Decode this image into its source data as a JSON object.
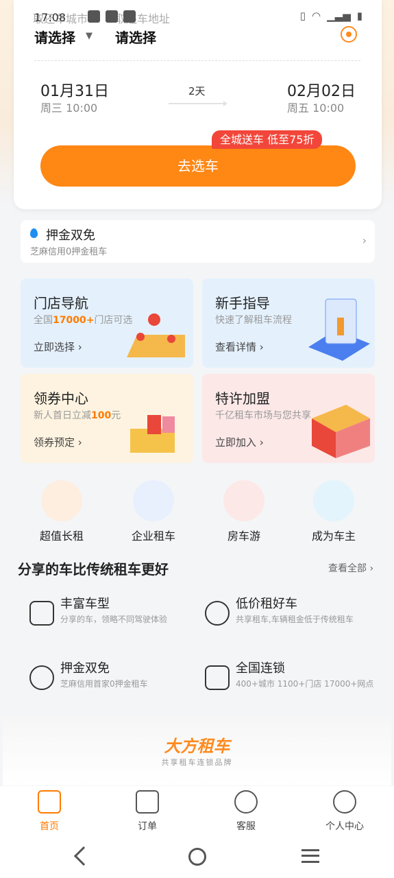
{
  "status": {
    "time": "17:08"
  },
  "booking": {
    "city_hint": "取还车城市",
    "addr_hint": "取还车地址",
    "city_value": "请选择",
    "addr_value": "请选择",
    "pickup_date": "01月31日",
    "pickup_week": "周三 10:00",
    "duration": "2天",
    "return_date": "02月02日",
    "return_week": "周五 10:00",
    "promo": "全城送车 低至75折",
    "go_label": "去选车"
  },
  "deposit": {
    "title": "押金双免",
    "sub": "芝麻信用0押金租车"
  },
  "tiles": [
    {
      "title": "门店导航",
      "sub_a": "全国",
      "sub_highlight": "17000+",
      "sub_b": "门店可选",
      "action": "立即选择"
    },
    {
      "title": "新手指导",
      "sub": "快速了解租车流程",
      "action": "查看详情"
    },
    {
      "title": "领券中心",
      "sub_a": "新人首日立减",
      "sub_highlight": "100",
      "sub_b": "元",
      "action": "领券预定"
    },
    {
      "title": "特许加盟",
      "sub": "千亿租车市场与您共享",
      "action": "立即加入"
    }
  ],
  "quick": [
    {
      "label": "超值长租",
      "color": "#fdeee0"
    },
    {
      "label": "企业租车",
      "color": "#e8f0fd"
    },
    {
      "label": "房车游",
      "color": "#fde8e8"
    },
    {
      "label": "成为车主",
      "color": "#e3f4fc"
    }
  ],
  "section": {
    "title": "分享的车比传统租车更好",
    "more": "查看全部"
  },
  "features": [
    {
      "title": "丰富车型",
      "sub": "分享的车，领略不同驾驶体验"
    },
    {
      "title": "低价租好车",
      "sub": "共享租车,车辆租金低于传统租车"
    },
    {
      "title": "押金双免",
      "sub": "芝麻信用首家0押金租车"
    },
    {
      "title": "全国连锁",
      "sub": "400+城市 1100+门店 17000+网点"
    }
  ],
  "brand": {
    "name": "大方租车",
    "sub": "共享租车连锁品牌"
  },
  "tabs": [
    "首页",
    "订单",
    "客服",
    "个人中心"
  ],
  "colors": {
    "accent": "#ff8714",
    "promo": "#f2463a",
    "active_tab": "#ff7a00"
  }
}
